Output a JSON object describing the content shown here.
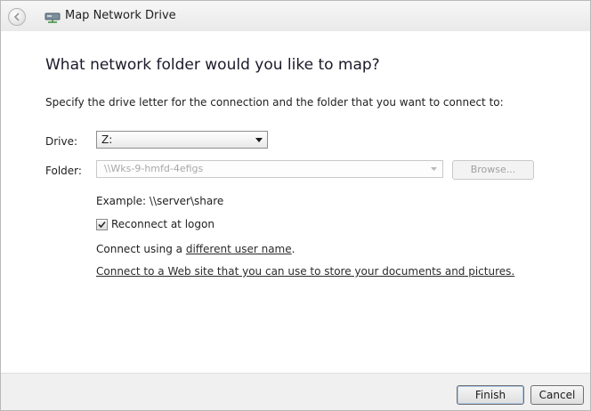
{
  "window": {
    "title": "Map Network Drive"
  },
  "main": {
    "heading": "What network folder would you like to map?",
    "instruction": "Specify the drive letter for the connection and the folder that you want to connect to:",
    "drive": {
      "label": "Drive:",
      "value": "Z:"
    },
    "folder": {
      "label": "Folder:",
      "value": "\\\\Wks-9-hmfd-4efigs",
      "browse_label": "Browse..."
    },
    "example": "Example: \\\\server\\share",
    "reconnect": {
      "label": "Reconnect at logon",
      "checked": true
    },
    "connect_using": {
      "prefix": "Connect using a ",
      "link": "different user name",
      "suffix": "."
    },
    "web_link": "Connect to a Web site that you can use to store your documents and pictures."
  },
  "footer": {
    "finish_label": "Finish",
    "cancel_label": "Cancel"
  },
  "icons": {
    "back": "back-arrow-icon",
    "title": "network-drive-icon",
    "dropdown": "chevron-down-icon",
    "check": "checkmark-icon"
  }
}
